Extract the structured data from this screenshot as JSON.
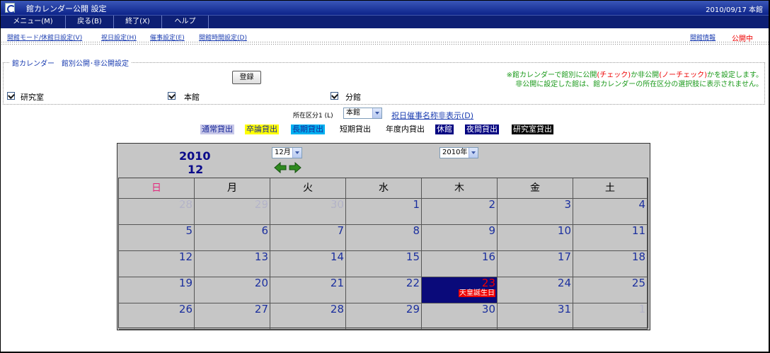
{
  "window": {
    "title": "館カレンダー公開 設定",
    "date_location": "2010/09/17 本館"
  },
  "menu": [
    {
      "label": "メニュー(M)"
    },
    {
      "label": "戻る(B)"
    },
    {
      "label": "終了(X)"
    },
    {
      "label": "ヘルプ"
    }
  ],
  "links": {
    "mode": "開館モード/休館日設定(V)",
    "holiday": "祝日設定(H)",
    "event": "催事設定(E)",
    "hours": "開館時間設定(D)",
    "info": "開館情報",
    "status": "公開中"
  },
  "settings": {
    "group_label": "館カレンダー　館別公開･非公開設定",
    "register_label": "登録",
    "note_line1_a": "※館カレンダーで館別に公開",
    "note_line1_check": "(チェック)",
    "note_line1_b": "か非公開",
    "note_line1_nocheck": "(ノーチェック)",
    "note_line1_c": "かを設定します。",
    "note_line2": "非公開に設定した館は、館カレンダーの所在区分の選択肢に表示されません。",
    "halls": [
      {
        "label": "研究室",
        "checked": true
      },
      {
        "label": "本館",
        "checked": true
      },
      {
        "label": "分館",
        "checked": true
      }
    ]
  },
  "area": {
    "label": "所在区分1 (L)",
    "value": "本館",
    "holiday_toggle": "祝日催事名称非表示(D)"
  },
  "legend": [
    {
      "label": "通常貸出",
      "bg": "#c8c8e8",
      "fg": "#1a2a9a"
    },
    {
      "label": "卒論貸出",
      "bg": "#ffff00",
      "fg": "#1a2a9a"
    },
    {
      "label": "長期貸出",
      "bg": "#00b0f0",
      "fg": "#1a2a9a"
    },
    {
      "label": "短期貸出",
      "bg": "#ffffff",
      "fg": "#000000"
    },
    {
      "label": "年度内貸出",
      "bg": "#ffffff",
      "fg": "#000000"
    },
    {
      "label": "休館",
      "bg": "#000080",
      "fg": "#ffffff"
    },
    {
      "label": "夜間貸出",
      "bg": "#000080",
      "fg": "#ffffff"
    },
    {
      "label": "研究室貸出",
      "bg": "#000000",
      "fg": "#ffffff"
    }
  ],
  "calendar": {
    "year": "2010",
    "month": "12",
    "month_select": "12月",
    "year_select": "2010年",
    "weekdays": [
      "日",
      "月",
      "火",
      "水",
      "木",
      "金",
      "土"
    ],
    "weeks": [
      [
        "28",
        "29",
        "30",
        "1",
        "2",
        "3",
        "4"
      ],
      [
        "5",
        "6",
        "7",
        "8",
        "9",
        "10",
        "11"
      ],
      [
        "12",
        "13",
        "14",
        "15",
        "16",
        "17",
        "18"
      ],
      [
        "19",
        "20",
        "21",
        "22",
        "23",
        "24",
        "25"
      ],
      [
        "26",
        "27",
        "28",
        "29",
        "30",
        "31",
        "1"
      ]
    ],
    "holiday_name": "天皇誕生日"
  },
  "colors": {
    "titlebar": "#0c238a",
    "menubar": "#0d1f74",
    "link": "#1a3cb0",
    "note": "#1b9a1b",
    "sunday": "#e0267a",
    "holiday_bg": "#0a0a7a"
  }
}
